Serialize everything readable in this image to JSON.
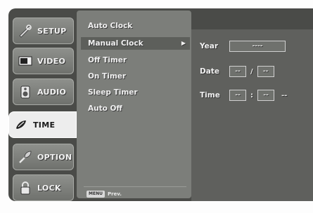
{
  "tabs": [
    {
      "label": "SETUP",
      "icon": "setup-icon",
      "active": false
    },
    {
      "label": "VIDEO",
      "icon": "video-icon",
      "active": false
    },
    {
      "label": "AUDIO",
      "icon": "audio-icon",
      "active": false
    },
    {
      "label": "TIME",
      "icon": "time-icon",
      "active": true
    },
    {
      "label": "OPTION",
      "icon": "option-icon",
      "active": false
    },
    {
      "label": "LOCK",
      "icon": "lock-icon",
      "active": false
    }
  ],
  "menu": {
    "items": [
      "Auto Clock",
      "Manual Clock",
      "Off Timer",
      "On Timer",
      "Sleep Timer",
      "Auto Off"
    ],
    "selected": "Manual Clock",
    "arrow": "▶",
    "footer_key": "MENU",
    "footer_label": "Prev."
  },
  "panel": {
    "year_label": "Year",
    "year_value": "----",
    "date_label": "Date",
    "date_month": "--",
    "date_sep": "/",
    "date_day": "--",
    "time_label": "Time",
    "time_hour": "--",
    "time_sep": ":",
    "time_min": "--",
    "time_ampm": "--"
  }
}
